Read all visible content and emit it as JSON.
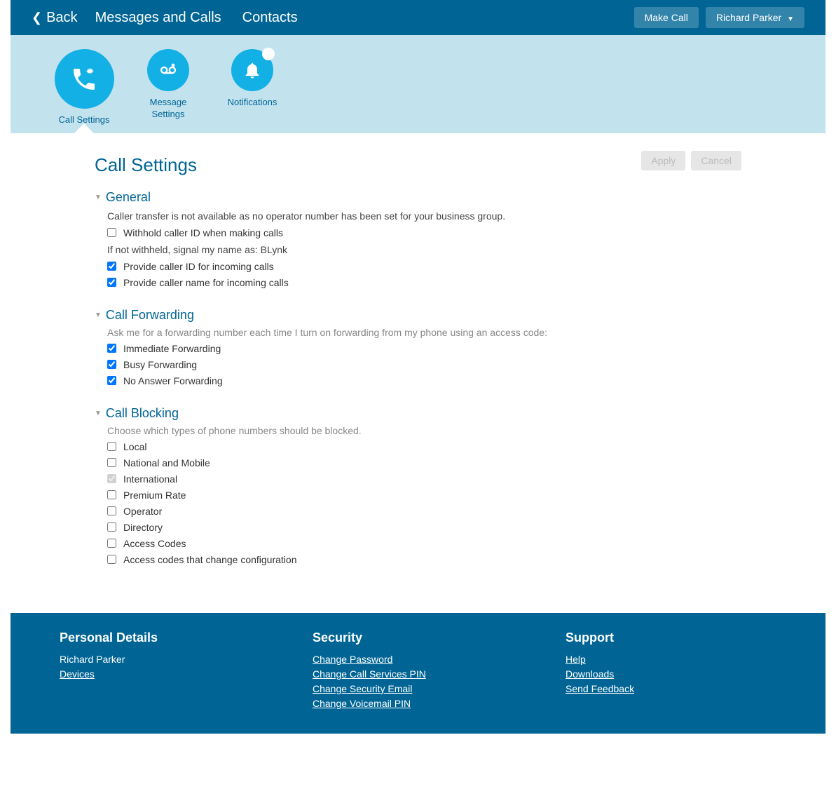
{
  "topbar": {
    "back": "Back",
    "nav": [
      "Messages and Calls",
      "Contacts"
    ],
    "make_call": "Make Call",
    "user": "Richard Parker"
  },
  "tabs": [
    {
      "label": "Call Settings",
      "icon": "phone-gear",
      "active": true
    },
    {
      "label": "Message Settings",
      "icon": "voicemail-gear",
      "active": false
    },
    {
      "label": "Notifications",
      "icon": "bell",
      "active": false,
      "badge": true
    }
  ],
  "page": {
    "title": "Call Settings",
    "apply": "Apply",
    "cancel": "Cancel"
  },
  "sections": {
    "general": {
      "title": "General",
      "note1": "Caller transfer is not available as no operator number has been set for your business group.",
      "cb_withhold": {
        "label": "Withhold caller ID when making calls",
        "checked": false
      },
      "signal_line": "If not withheld, signal my name as: BLynk",
      "cb_provide_id": {
        "label": "Provide caller ID for incoming calls",
        "checked": true
      },
      "cb_provide_name": {
        "label": "Provide caller name for incoming calls",
        "checked": true
      }
    },
    "forwarding": {
      "title": "Call Forwarding",
      "note": "Ask me for a forwarding number each time I turn on forwarding from my phone using an access code:",
      "items": [
        {
          "label": "Immediate Forwarding",
          "checked": true
        },
        {
          "label": "Busy Forwarding",
          "checked": true
        },
        {
          "label": "No Answer Forwarding",
          "checked": true
        }
      ]
    },
    "blocking": {
      "title": "Call Blocking",
      "note": "Choose which types of phone numbers should be blocked.",
      "items": [
        {
          "label": "Local",
          "checked": false,
          "disabled": false
        },
        {
          "label": "National and Mobile",
          "checked": false,
          "disabled": false
        },
        {
          "label": "International",
          "checked": true,
          "disabled": true
        },
        {
          "label": "Premium Rate",
          "checked": false,
          "disabled": false
        },
        {
          "label": "Operator",
          "checked": false,
          "disabled": false
        },
        {
          "label": "Directory",
          "checked": false,
          "disabled": false
        },
        {
          "label": "Access Codes",
          "checked": false,
          "disabled": false
        },
        {
          "label": "Access codes that change configuration",
          "checked": false,
          "disabled": false
        }
      ]
    }
  },
  "footer": {
    "cols": [
      {
        "title": "Personal Details",
        "items": [
          {
            "label": "Richard Parker",
            "link": false
          },
          {
            "label": "Devices",
            "link": true
          }
        ]
      },
      {
        "title": "Security",
        "items": [
          {
            "label": "Change Password",
            "link": true
          },
          {
            "label": "Change Call Services PIN",
            "link": true
          },
          {
            "label": "Change Security Email",
            "link": true
          },
          {
            "label": "Change Voicemail PIN",
            "link": true
          }
        ]
      },
      {
        "title": "Support",
        "items": [
          {
            "label": "Help",
            "link": true
          },
          {
            "label": "Downloads",
            "link": true
          },
          {
            "label": "Send Feedback",
            "link": true
          }
        ]
      }
    ]
  }
}
